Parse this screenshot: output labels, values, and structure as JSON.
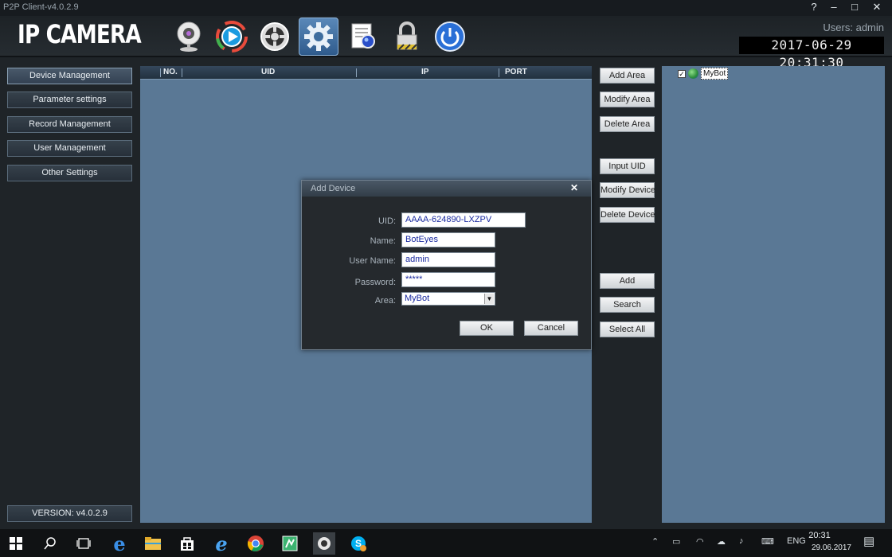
{
  "window": {
    "title": "P2P Client-v4.0.2.9",
    "help": "?",
    "minimize": "–",
    "maximize": "□",
    "close": "✕"
  },
  "header": {
    "logo": "IP CAMERA",
    "users": "Users: admin",
    "datetime": "2017-06-29 20:31:30",
    "tools": [
      {
        "name": "camera-tool",
        "icon": "webcam-icon"
      },
      {
        "name": "playback-tool",
        "icon": "play-icon"
      },
      {
        "name": "ptz-tool",
        "icon": "ptz-wheel-icon"
      },
      {
        "name": "settings-tool",
        "icon": "gear-icon",
        "active": true
      },
      {
        "name": "log-tool",
        "icon": "document-search-icon"
      },
      {
        "name": "lock-tool",
        "icon": "lock-icon"
      },
      {
        "name": "power-tool",
        "icon": "power-icon"
      }
    ]
  },
  "nav": {
    "items": [
      {
        "label": "Device Management"
      },
      {
        "label": "Parameter settings"
      },
      {
        "label": "Record Management"
      },
      {
        "label": "User Management"
      },
      {
        "label": "Other Settings"
      }
    ],
    "version": "VERSION: v4.0.2.9"
  },
  "table": {
    "columns": [
      "NO.",
      "UID",
      "IP",
      "PORT"
    ],
    "rows": []
  },
  "actions": {
    "add_area": "Add Area",
    "modify_area": "Modify Area",
    "delete_area": "Delete Area",
    "input_uid": "Input UID",
    "modify_device": "Modify Device",
    "delete_device": "Delete Device",
    "add": "Add",
    "search": "Search",
    "select_all": "Select All"
  },
  "tree": {
    "item_label": "MyBot",
    "checked": true
  },
  "dialog": {
    "title": "Add Device",
    "close": "✕",
    "uid_label": "UID:",
    "uid_value": "AAAA-624890-LXZPV",
    "name_label": "Name:",
    "name_value": "BotEyes",
    "username_label": "User Name:",
    "username_value": "admin",
    "password_label": "Password:",
    "password_value": "*****",
    "area_label": "Area:",
    "area_value": "MyBot",
    "ok": "OK",
    "cancel": "Cancel"
  },
  "taskbar": {
    "lang": "ENG",
    "time": "20:31",
    "date": "29.06.2017",
    "apps": [
      "windows-start",
      "search",
      "task-view",
      "edge",
      "file-explorer",
      "store",
      "internet-explorer",
      "chrome",
      "maps",
      "ip-camera",
      "skype"
    ]
  },
  "colors": {
    "panel_bg": "#5a7895",
    "app_bg": "#1f2428",
    "accent": "#2f5b8c"
  }
}
